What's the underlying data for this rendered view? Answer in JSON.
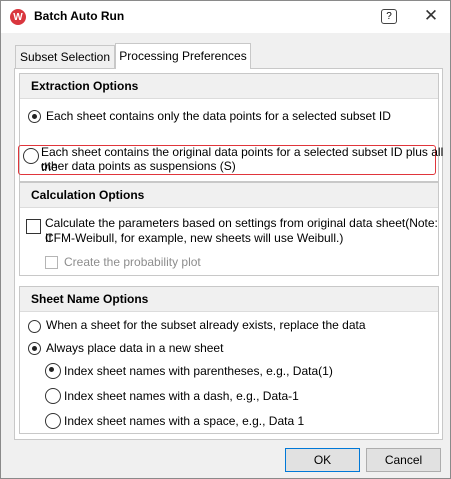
{
  "window": {
    "title": "Batch Auto Run",
    "icon": "weibull-w-logo",
    "help_label": "?",
    "close_label": "✕"
  },
  "tabs": [
    {
      "label": "Subset Selection",
      "active": false
    },
    {
      "label": "Processing Preferences",
      "active": true
    }
  ],
  "extraction": {
    "header": "Extraction Options",
    "option1": "Each sheet contains only the data points for a selected subset ID",
    "option2_line1": "Each sheet contains the original data points for a selected subset ID plus all the",
    "option2_line2": "other data points as suspensions (S)",
    "selected": "option1"
  },
  "calculation": {
    "header": "Calculation Options",
    "check1_line1": "Calculate the parameters based on settings from original data sheet(Note: If",
    "check1_line2": "CFM-Weibull, for example, new sheets will use Weibull.)",
    "check2": "Create the probability plot"
  },
  "sheet_name": {
    "header": "Sheet Name Options",
    "option_replace": "When a sheet for the subset already exists, replace the data",
    "option_new": "Always place data in a new sheet",
    "sub_parentheses": "Index sheet names with parentheses, e.g., Data(1)",
    "sub_dash": "Index sheet names with a dash, e.g., Data-1",
    "sub_space": "Index sheet names with a space, e.g., Data 1"
  },
  "buttons": {
    "ok": "OK",
    "cancel": "Cancel"
  },
  "colors": {
    "highlight": "#e0353b",
    "accent": "#0078d7"
  }
}
